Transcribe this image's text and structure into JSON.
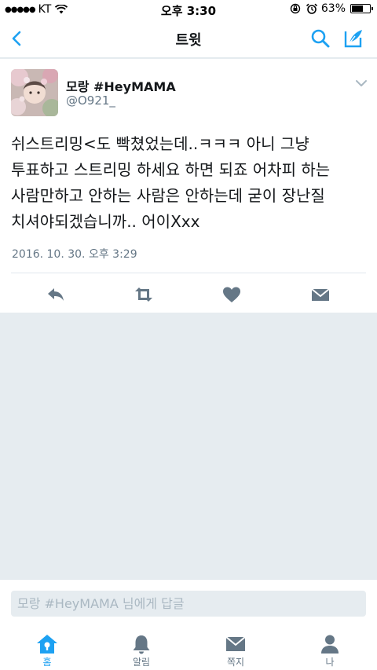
{
  "status_bar": {
    "signal": "●●●●●",
    "carrier": "KT",
    "time": "오후 3:30",
    "battery": "63%",
    "battery_level": 0.63
  },
  "nav": {
    "title": "트윗"
  },
  "tweet": {
    "display_name": "모랑 #HeyMAMA",
    "handle": "@O921_",
    "text": "쉬스트리밍<도 빡쳤었는데..ㅋㅋㅋ 아니 그냥 투표하고 스트리밍 하세요 하면 되죠 어차피 하는 사람만하고 안하는 사람은 안하는데 굳이 장난질 치셔야되겠습니까.. 어이Xxx",
    "timestamp": "2016. 10. 30. 오후 3:29"
  },
  "reply": {
    "placeholder": "모랑 #HeyMAMA 님에게 답글"
  },
  "tabs": [
    {
      "label": "홈",
      "icon": "home-icon",
      "active": true
    },
    {
      "label": "알림",
      "icon": "bell-icon",
      "active": false
    },
    {
      "label": "쪽지",
      "icon": "envelope-icon",
      "active": false
    },
    {
      "label": "나",
      "icon": "person-icon",
      "active": false
    }
  ],
  "colors": {
    "accent": "#1da1f2",
    "icon_gray": "#657786",
    "background": "#e6ecf0"
  }
}
